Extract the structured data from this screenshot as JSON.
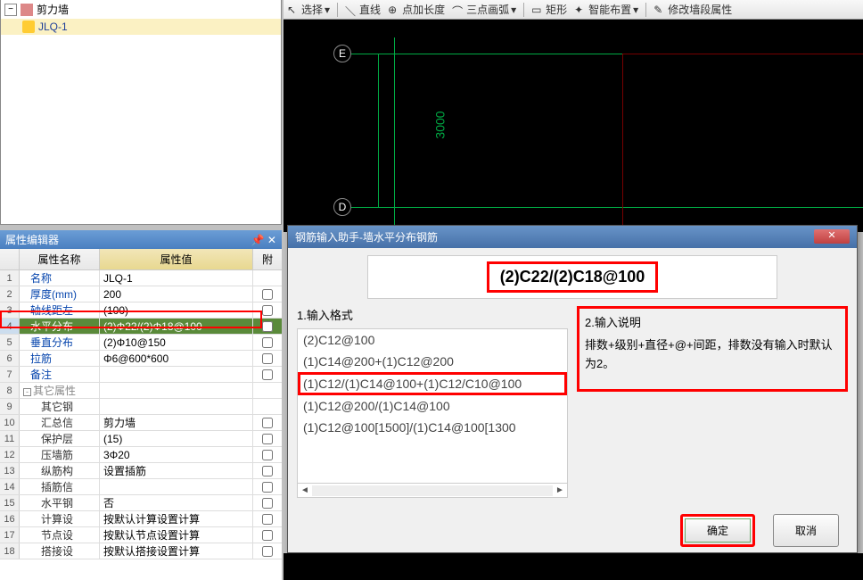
{
  "tree": {
    "root": "剪力墙",
    "child": "JLQ-1"
  },
  "toolbar": {
    "select": "选择",
    "line": "直线",
    "point_length": "点加长度",
    "arc3": "三点画弧",
    "rect": "矩形",
    "smart": "智能布置",
    "modify": "修改墙段属性"
  },
  "viewport": {
    "bubble_e": "E",
    "bubble_d": "D",
    "dim1": "3000"
  },
  "properties": {
    "title": "属性编辑器",
    "header": {
      "name": "属性名称",
      "value": "属性值",
      "attach": "附"
    },
    "rows": [
      {
        "n": "1",
        "name": "名称",
        "value": "JLQ-1",
        "link": true,
        "cb": false
      },
      {
        "n": "2",
        "name": "厚度(mm)",
        "value": "200",
        "link": true,
        "cb": true
      },
      {
        "n": "3",
        "name": "轴线距左",
        "value": "(100)",
        "link": true,
        "cb": true
      },
      {
        "n": "4",
        "name": "水平分布",
        "value": "(2)Φ22/(2)Φ18@100",
        "link": true,
        "selected": true,
        "cb": true
      },
      {
        "n": "5",
        "name": "垂直分布",
        "value": "(2)Φ10@150",
        "link": true,
        "cb": true
      },
      {
        "n": "6",
        "name": "拉筋",
        "value": "Φ6@600*600",
        "link": true,
        "cb": true
      },
      {
        "n": "7",
        "name": "备注",
        "value": "",
        "link": true,
        "cb": true
      },
      {
        "n": "8",
        "name": "其它属性",
        "value": "",
        "group": true,
        "cb": false
      },
      {
        "n": "9",
        "name": "其它钢",
        "value": "",
        "indent": true,
        "cb": false
      },
      {
        "n": "10",
        "name": "汇总信",
        "value": "剪力墙",
        "indent": true,
        "cb": true
      },
      {
        "n": "11",
        "name": "保护层",
        "value": "(15)",
        "indent": true,
        "cb": true
      },
      {
        "n": "12",
        "name": "压墙筋",
        "value": "3Φ20",
        "indent": true,
        "cb": true
      },
      {
        "n": "13",
        "name": "纵筋构",
        "value": "设置插筋",
        "indent": true,
        "cb": true
      },
      {
        "n": "14",
        "name": "插筋信",
        "value": "",
        "indent": true,
        "cb": true
      },
      {
        "n": "15",
        "name": "水平钢",
        "value": "否",
        "indent": true,
        "cb": true
      },
      {
        "n": "16",
        "name": "计算设",
        "value": "按默认计算设置计算",
        "indent": true,
        "cb": true
      },
      {
        "n": "17",
        "name": "节点设",
        "value": "按默认节点设置计算",
        "indent": true,
        "cb": true
      },
      {
        "n": "18",
        "name": "搭接设",
        "value": "按默认搭接设置计算",
        "indent": true,
        "cb": true
      }
    ]
  },
  "dialog": {
    "title": "钢筋输入助手-墙水平分布钢筋",
    "input_value": "(2)C22/(2)C18@100",
    "format_label": "1.输入格式",
    "desc_label": "2.输入说明",
    "formats": [
      "(2)C12@100",
      "(1)C14@200+(1)C12@200",
      "(1)C12/(1)C14@100+(1)C12/C10@100",
      "(1)C12@200/(1)C14@100",
      "(1)C12@100[1500]/(1)C14@100[1300"
    ],
    "description": "排数+级别+直径+@+间距，排数没有输入时默认为2。",
    "ok": "确定",
    "cancel": "取消"
  }
}
